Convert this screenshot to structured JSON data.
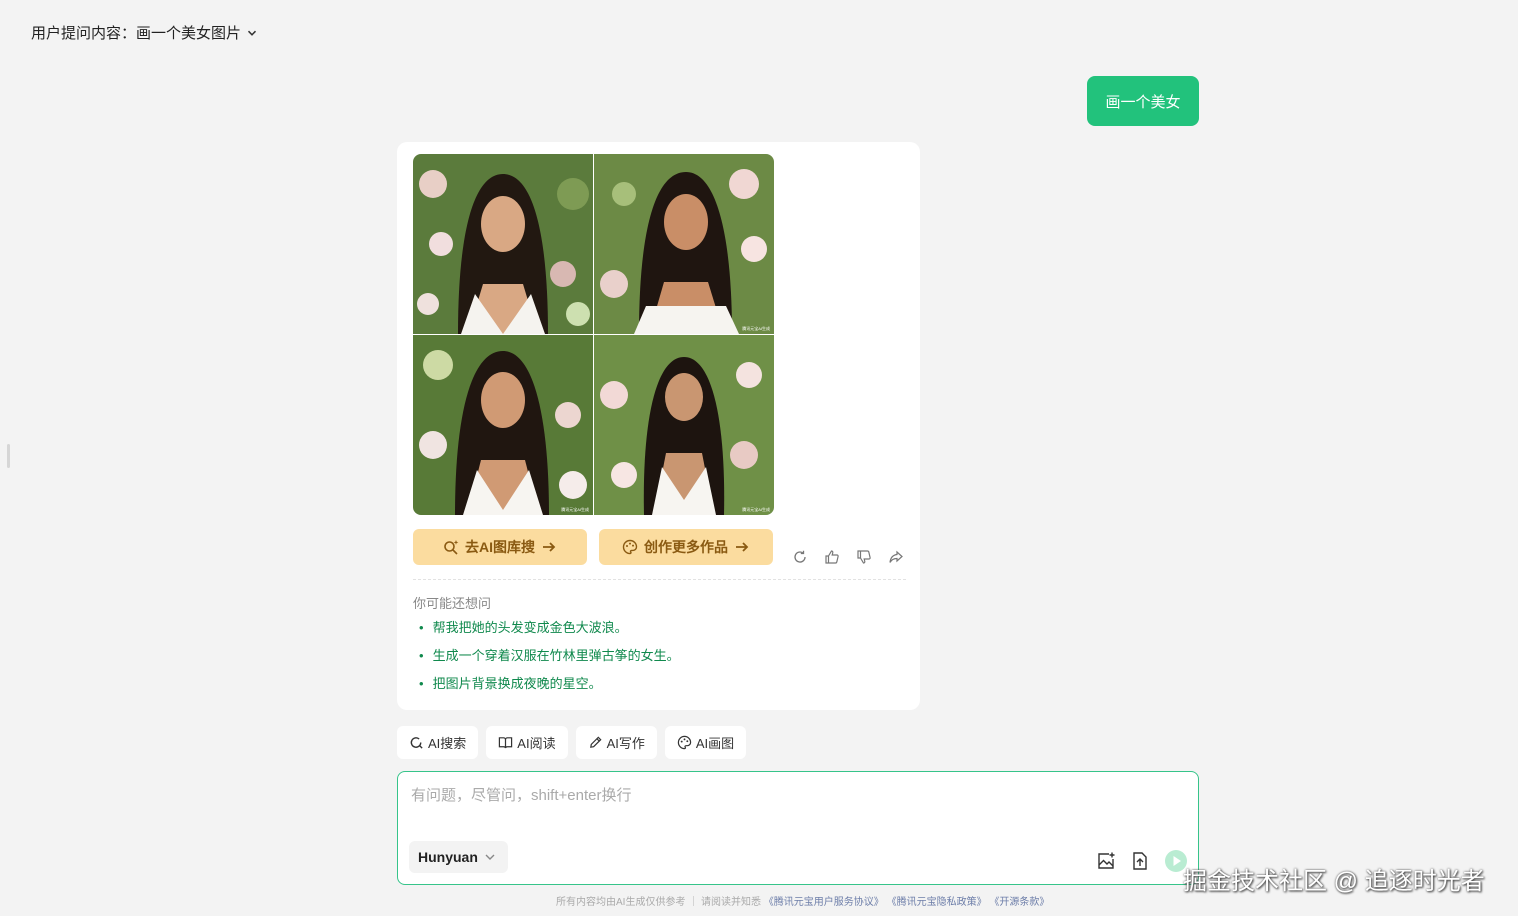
{
  "header": {
    "prompt_label": "用户提问内容：",
    "prompt_value": "画一个美女图片"
  },
  "user_message": "画一个美女",
  "answer": {
    "images": [
      {
        "alt": "AI生成美女图片1",
        "watermark": ""
      },
      {
        "alt": "AI生成美女图片2",
        "watermark": "腾讯元宝AI生成"
      },
      {
        "alt": "AI生成美女图片3",
        "watermark": "腾讯元宝AI生成"
      },
      {
        "alt": "AI生成美女图片4",
        "watermark": "腾讯元宝AI生成"
      }
    ],
    "buttons": {
      "library": "去AI图库搜",
      "create_more": "创作更多作品"
    },
    "suggest_title": "你可能还想问",
    "suggestions": [
      "帮我把她的头发变成金色大波浪。",
      "生成一个穿着汉服在竹林里弹古筝的女生。",
      "把图片背景换成夜晚的星空。"
    ]
  },
  "quick_tools": [
    {
      "label": "AI搜索",
      "icon": "search-icon"
    },
    {
      "label": "AI阅读",
      "icon": "book-icon"
    },
    {
      "label": "AI写作",
      "icon": "pen-icon"
    },
    {
      "label": "AI画图",
      "icon": "palette-icon"
    }
  ],
  "input": {
    "placeholder": "有问题，尽管问，shift+enter换行",
    "value": "",
    "model": "Hunyuan"
  },
  "footer": {
    "disclaimer": "所有内容均由AI生成仅供参考 ｜ 请阅读并知悉",
    "terms": "《腾讯元宝用户服务协议》",
    "privacy": "《腾讯元宝隐私政策》",
    "opensource": "《开源条款》"
  },
  "watermark": "掘金技术社区 @ 追逐时光者",
  "colors": {
    "accent": "#22c27c",
    "button_bg": "#fbdc9f",
    "button_text": "#8a5a12",
    "suggest": "#10894d"
  }
}
